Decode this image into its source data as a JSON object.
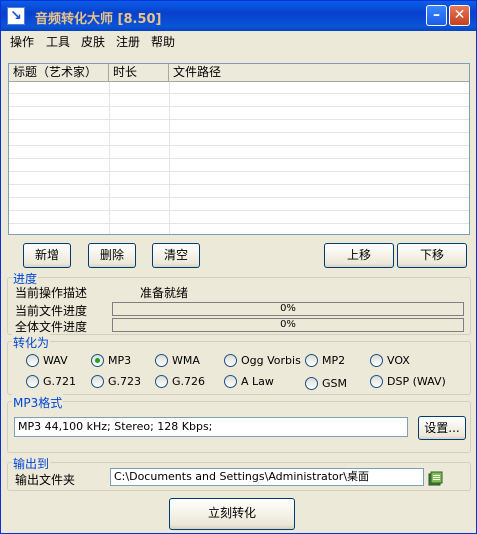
{
  "window": {
    "title": "音频转化大师 [8.50]"
  },
  "menu": [
    "操作",
    "工具",
    "皮肤",
    "注册",
    "帮助"
  ],
  "table": {
    "columns": [
      "标题（艺术家）",
      "时长",
      "文件路径"
    ],
    "rows": []
  },
  "list_buttons": {
    "add": "新增",
    "delete": "删除",
    "clear": "清空",
    "move_up": "上移",
    "move_down": "下移"
  },
  "progress": {
    "legend": "进度",
    "current_op_label": "当前操作描述",
    "current_op_value": "准备就绪",
    "file_progress_label": "当前文件进度",
    "file_progress_value": "0%",
    "file_progress_fraction": 0,
    "total_progress_label": "全体文件进度",
    "total_progress_value": "0%",
    "total_progress_fraction": 0
  },
  "convert": {
    "legend": "转化为",
    "options": [
      "WAV",
      "MP3",
      "WMA",
      "Ogg Vorbis",
      "MP2",
      "VOX",
      "G.721",
      "G.723",
      "G.726",
      "A Law",
      "GSM",
      "DSP (WAV)"
    ],
    "selected": "MP3"
  },
  "format": {
    "legend": "MP3格式",
    "value": "MP3 44,100 kHz; Stereo;  128 Kbps;",
    "settings_button": "设置..."
  },
  "output": {
    "legend": "输出到",
    "folder_label": "输出文件夹",
    "folder_value": "C:\\Documents and Settings\\Administrator\\桌面"
  },
  "convert_button": "立刻转化",
  "colors": {
    "titlebar": "#0a5ee8",
    "title_text": "#e8c48a",
    "legend": "#0046d5",
    "window_bg": "#ece9d8"
  }
}
